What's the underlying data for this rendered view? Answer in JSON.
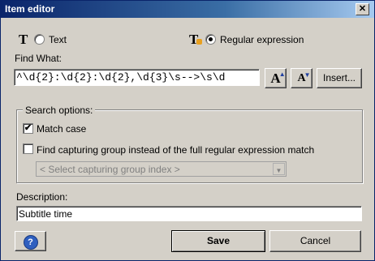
{
  "window": {
    "title": "Item editor",
    "close_glyph": "✕"
  },
  "mode": {
    "text_option": {
      "icon": "T",
      "label": "Text",
      "checked": false
    },
    "regex_option": {
      "icon": "T",
      "label": "Regular expression",
      "checked": true
    }
  },
  "find": {
    "label": "Find What:",
    "value": "^\\d{2}:\\d{2}:\\d{2},\\d{3}\\s-->\\s\\d",
    "increase_font_glyph": "A",
    "decrease_font_glyph": "A",
    "insert_button": "Insert..."
  },
  "search_options": {
    "title": "Search options:",
    "match_case": {
      "label": "Match case",
      "checked": true
    },
    "capturing_group": {
      "label": "Find capturing group instead of the full regular expression match",
      "checked": false
    },
    "group_select_placeholder": "< Select capturing group index >"
  },
  "description": {
    "label": "Description:",
    "value": "Subtitle time"
  },
  "buttons": {
    "help_glyph": "?",
    "save": "Save",
    "cancel": "Cancel"
  }
}
